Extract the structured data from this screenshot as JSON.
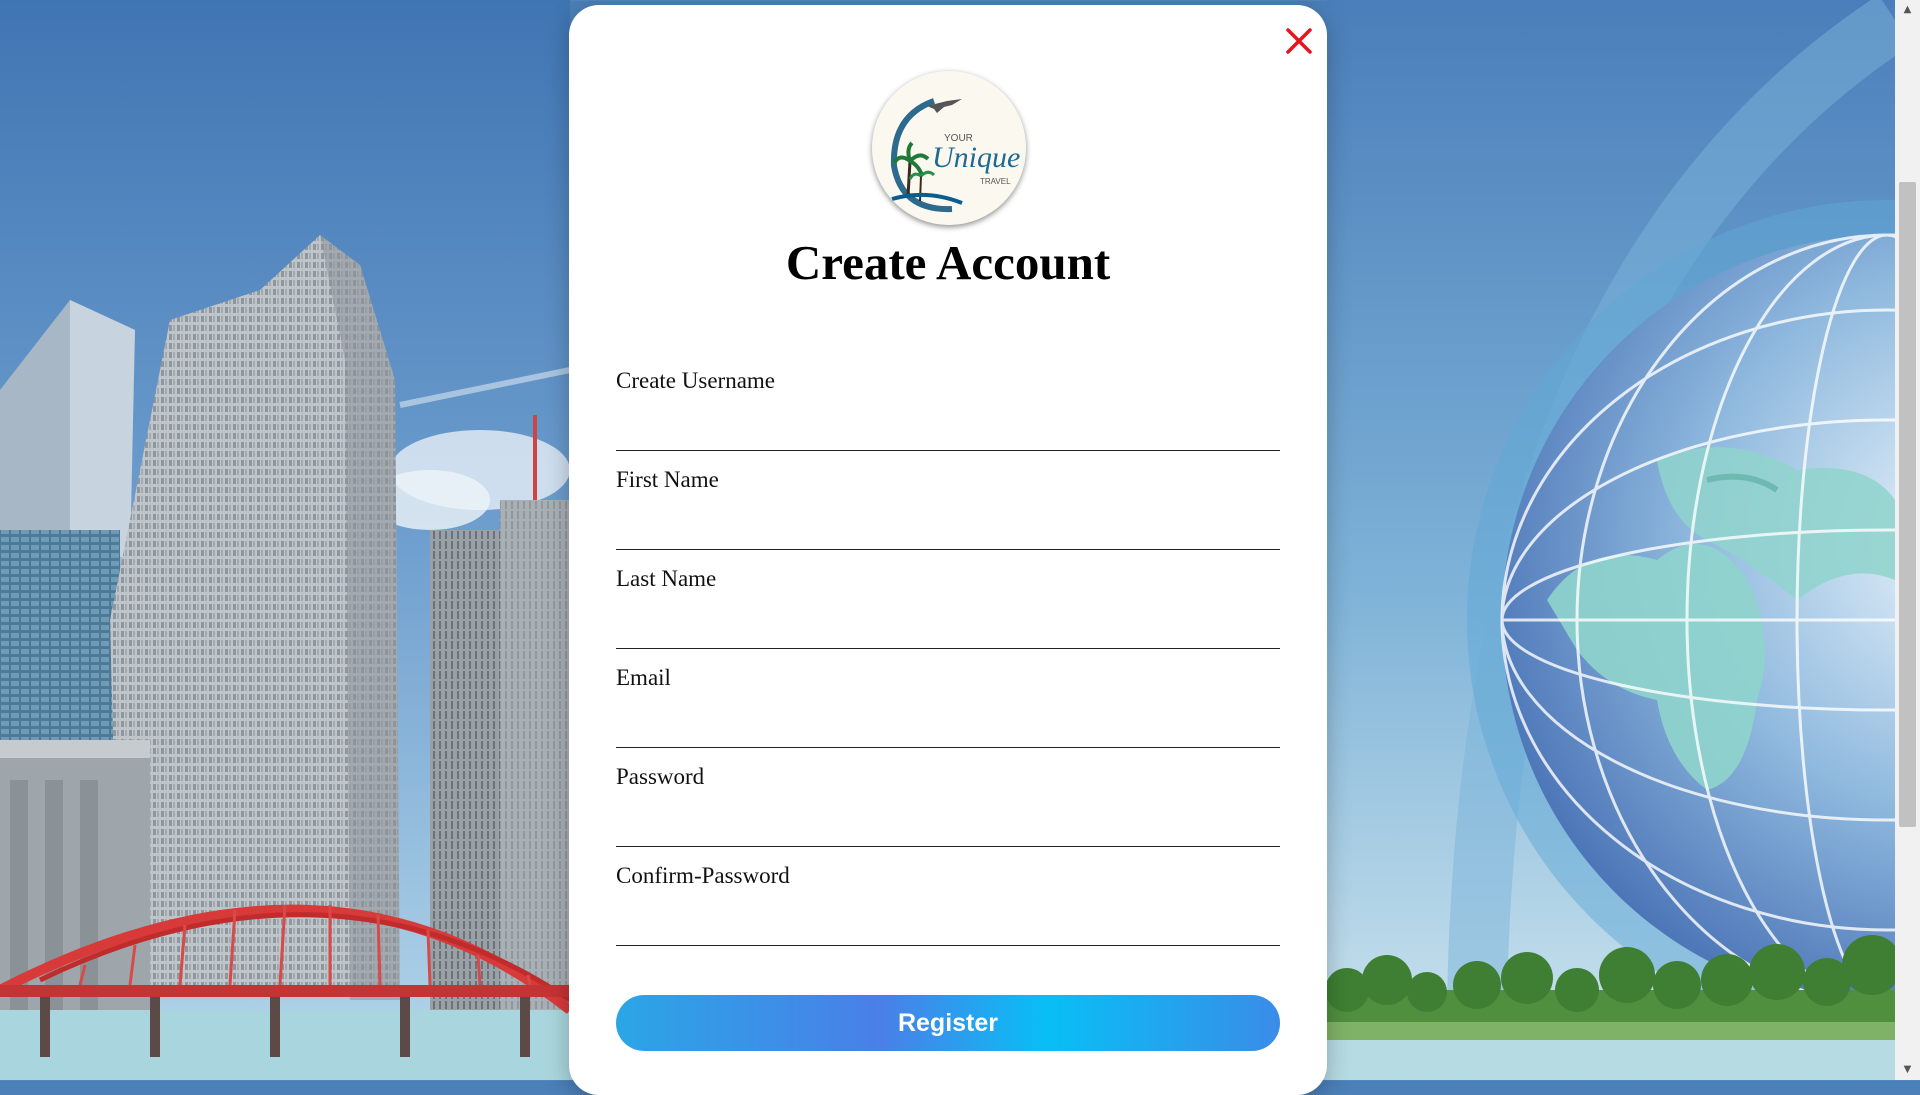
{
  "modal": {
    "title": "Create Account",
    "close_icon": "close-x-icon",
    "close_color": "#e8141b",
    "logo": {
      "icon": "your-unique-travel-logo",
      "text_top": "YOUR",
      "text_main": "Unique",
      "text_bottom": "TRAVEL"
    },
    "fields": [
      {
        "label": "Create Username",
        "value": ""
      },
      {
        "label": "First Name",
        "value": ""
      },
      {
        "label": "Last Name",
        "value": ""
      },
      {
        "label": "Email",
        "value": ""
      },
      {
        "label": "Password",
        "value": ""
      },
      {
        "label": "Confirm-Password",
        "value": ""
      }
    ],
    "register_label": "Register",
    "button_gradient": [
      "#2aa6e6",
      "#4a7fe8",
      "#08bff5",
      "#3a8ce8"
    ]
  },
  "background": {
    "left_scene": "city-skyline-with-red-bridge",
    "right_scene": "globe-with-trees"
  },
  "scrollbar": {
    "up_icon": "scroll-up-arrow-icon",
    "down_icon": "scroll-down-arrow-icon"
  }
}
